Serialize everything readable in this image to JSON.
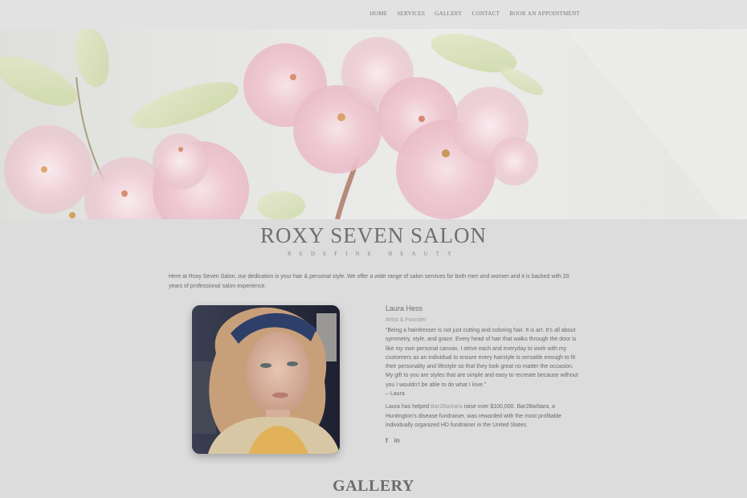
{
  "nav": {
    "items": [
      "HOME",
      "SERVICES",
      "GALLERY",
      "CONTACT",
      "BOOK AN APPOINTMENT"
    ]
  },
  "hero": {
    "image": "pink-cherry-blossom-photo"
  },
  "site": {
    "title": "ROXY SEVEN SALON",
    "tagline": "REDEFINE BEAUTY",
    "intro": "Here at Roxy Seven Salon, our dedication is your hair & personal style. We offer a wide range of salon services for both men and women and it is backed with 20 years of professional salon experience."
  },
  "bio": {
    "name": "Laura Hess",
    "role": "Artist & Founder",
    "quote": "“Being a hairdresser is not just cutting and coloring hair. It is art. It’s all about symmetry, style, and grace. Every head of hair that walks through the door is like my own personal canvas. I strive each and everyday to work with my customers as an individual to ensure every hairstyle is versatile enough to fit their personality and lifestyle so that they look great no matter the occasion. My gift to you are styles that are simple and easy to recreate because without you I wouldn’t be able to do what I love.”",
    "attribution": "– Laura",
    "extra_before": "Laura has helped ",
    "extra_link": "Bar2Barbara",
    "extra_after": "  raise over $100,000. Bar2Barbara, a Huntington’s disease fundraiser, was rewarded with the most profitable individually organized HD fundraiser in the United States.",
    "social": [
      {
        "icon": "facebook-icon",
        "label": "f"
      },
      {
        "icon": "linkedin-icon",
        "label": "in"
      }
    ]
  },
  "gallery": {
    "title": "GALLERY"
  }
}
